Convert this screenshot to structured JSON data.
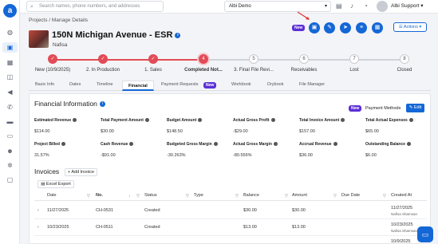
{
  "search": {
    "placeholder": "Search names, phone numbers, and addresses"
  },
  "company": {
    "name": "Albi Demo"
  },
  "user": {
    "name": "Albi Support"
  },
  "breadcrumb": "Projects / Manage Details",
  "project": {
    "title": "150N Michigan Avenue - ESR",
    "subtitle": "Nafisa"
  },
  "new_badge": "New",
  "actions_label": "Actions",
  "stepper": [
    {
      "num": "",
      "label": "New (10/9/2025)",
      "state": "done"
    },
    {
      "num": "",
      "label": "2. In Production",
      "state": "done"
    },
    {
      "num": "",
      "label": "1. Sales",
      "state": "done"
    },
    {
      "num": "4",
      "label": "Completed Not...",
      "state": "current"
    },
    {
      "num": "5",
      "label": "3. Final File Revi...",
      "state": "pending"
    },
    {
      "num": "6",
      "label": "Receivables",
      "state": "pending"
    },
    {
      "num": "7",
      "label": "Lost",
      "state": "pending"
    },
    {
      "num": "8",
      "label": "Closed",
      "state": "pending"
    }
  ],
  "tabs": [
    "Basic Info",
    "Dates",
    "Timeline",
    "Financial",
    "Payment Requests",
    "Workbook",
    "Drybook",
    "File Manager"
  ],
  "financial": {
    "title": "Financial Information",
    "payment_methods": "Payment Methods",
    "edit": "Edit",
    "metrics": [
      {
        "label": "Estimated Revenue",
        "value": "$114.00"
      },
      {
        "label": "Total Payment Amount",
        "value": "$30.00"
      },
      {
        "label": "Budget Amount",
        "value": "$148.50"
      },
      {
        "label": "Actual Gross Profit",
        "value": "-$29.00"
      },
      {
        "label": "Total Invoice Amount",
        "value": "$157.00"
      },
      {
        "label": "Total Actual Expenses",
        "value": "$65.00"
      },
      {
        "label": "Project Billed",
        "value": "31.57%"
      },
      {
        "label": "Cash Revenue",
        "value": "-$91.00"
      },
      {
        "label": "Budgeted Gross Margin",
        "value": "-30.263%"
      },
      {
        "label": "Actual Gross Margin",
        "value": "-80.556%"
      },
      {
        "label": "Accrual Revenue",
        "value": "$36.00"
      },
      {
        "label": "Outstanding Balance",
        "value": "$6.00"
      }
    ]
  },
  "invoices": {
    "title": "Invoices",
    "add_label": "+ Add Invoice",
    "excel_label": "Excel Export",
    "columns": [
      "Date",
      "No.",
      "Status",
      "Type",
      "Balance",
      "Amount",
      "Due Date",
      "Created At"
    ],
    "rows": [
      {
        "date": "11/27/2025",
        "no": "CH-0531",
        "status": "Created",
        "type": "",
        "balance": "$30.00",
        "amount": "$30.00",
        "due": "",
        "created": "11/27/2025",
        "created_by": "Nafisa Shamsan"
      },
      {
        "date": "10/23/2025",
        "no": "CH-0511",
        "status": "Created",
        "type": "",
        "balance": "$13.00",
        "amount": "$13.00",
        "due": "",
        "created": "10/23/2025",
        "created_by": "Nafisa Shamsan"
      },
      {
        "date": "",
        "no": "",
        "status": "",
        "type": "",
        "balance": "",
        "amount": "",
        "due": "",
        "created": "10/9/2025",
        "created_by": ""
      }
    ]
  }
}
